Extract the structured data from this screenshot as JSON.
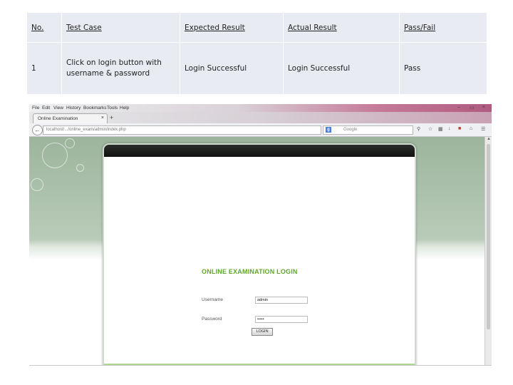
{
  "table": {
    "headers": [
      "No.",
      "Test Case",
      "Expected Result",
      "Actual Result",
      "Pass/Fail"
    ],
    "rows": [
      {
        "no": "1",
        "test_case": "Click on login button with username & password",
        "expected": "Login Successful",
        "actual": "Login Successful",
        "pass_fail": "Pass"
      }
    ]
  },
  "browser": {
    "menu": [
      "File",
      "Edit",
      "View",
      "History",
      "Bookmarks",
      "Tools",
      "Help"
    ],
    "window_controls": [
      "–",
      "▭",
      "×"
    ],
    "tab": {
      "title": "Online Examination",
      "close": "×"
    },
    "new_tab": "+",
    "url": "localhost/.../online_exam/admin/index.php",
    "search_engine": "g",
    "search_placeholder": "Google"
  },
  "page": {
    "heading": "ONLINE EXAMINATION LOGIN",
    "username_label": "Username",
    "username_value": "admin",
    "password_label": "Password",
    "password_value": "•••••",
    "login_button": "LOGIN"
  },
  "colors": {
    "table_cell_bg": "#e8ebf2",
    "login_title": "#5ea827",
    "page_bg_top": "#9cb49c",
    "frame_header": "#1a1d1a"
  }
}
